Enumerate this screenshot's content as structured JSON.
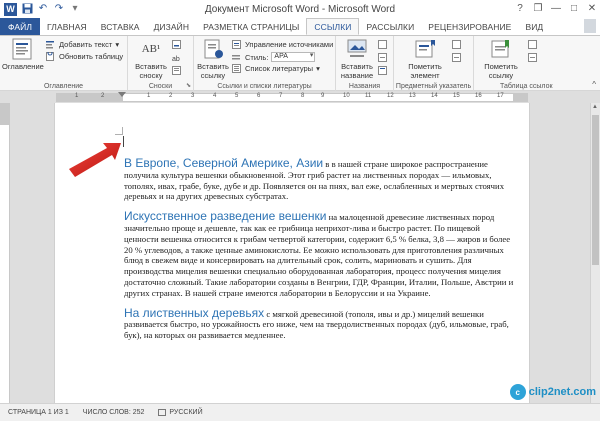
{
  "window": {
    "title": "Документ Microsoft Word - Microsoft Word",
    "help": "?",
    "restore": "❐",
    "minimize": "—",
    "maximize": "□",
    "close": "✕"
  },
  "quick_access": {
    "logo": "W",
    "save": "💾",
    "undo": "↶",
    "redo": "↷",
    "customize": "▾"
  },
  "tabs": [
    {
      "label": "ФАЙЛ"
    },
    {
      "label": "ГЛАВНАЯ"
    },
    {
      "label": "ВСТАВКА"
    },
    {
      "label": "ДИЗАЙН"
    },
    {
      "label": "РАЗМЕТКА СТРАНИЦЫ"
    },
    {
      "label": "ССЫЛКИ"
    },
    {
      "label": "РАССЫЛКИ"
    },
    {
      "label": "РЕЦЕНЗИРОВАНИЕ"
    },
    {
      "label": "ВИД"
    }
  ],
  "ribbon": {
    "toc_group": {
      "label": "Оглавление",
      "toc_button": "Оглавление",
      "add_text": "Добавить текст",
      "update_table": "Обновить таблицу"
    },
    "footnotes_group": {
      "label": "Сноски",
      "insert_footnote_1": "Вставить",
      "insert_footnote_2": "сноску",
      "footnote_icon": "AB¹"
    },
    "citations_group": {
      "label": "Ссылки и списки литературы",
      "insert_citation_1": "Вставить",
      "insert_citation_2": "ссылку",
      "manage_sources": "Управление источниками",
      "style_label": "Стиль:",
      "style_value": "APA",
      "bibliography": "Список литературы"
    },
    "captions_group": {
      "label": "Названия",
      "insert_caption_1": "Вставить",
      "insert_caption_2": "название"
    },
    "index_group": {
      "label": "Предметный указатель",
      "mark_entry_1": "Пометить",
      "mark_entry_2": "элемент"
    },
    "toa_group": {
      "label": "Таблица ссылок",
      "mark_citation_1": "Пометить",
      "mark_citation_2": "ссылку"
    },
    "collapse": "^"
  },
  "ruler": {
    "numbers": [
      "1",
      "2",
      "1",
      "2",
      "3",
      "4",
      "5",
      "6",
      "7",
      "8",
      "9",
      "10",
      "11",
      "12",
      "13",
      "14",
      "15",
      "16",
      "17"
    ]
  },
  "document": {
    "paragraphs": [
      {
        "heading": "В Европе, Северной Америке, Азии",
        "text": " в в нашей стране широкое распространение получила культура вешенки обыкновенной. Этот гриб растет на лиственных породах — ильмовых, тополях, ивах, грабе, буке, дубе и др. Появляется он на пнях, вал еже, ослабленных и мертвых стоячих деревьях и на других древесных субстратах."
      },
      {
        "heading": "Искусственное разведение вешенки",
        "text": " на малоценной древесине лиственных пород значительно проще и дешевле, так как ее грибница неприхот-лива и быстро растет. По пищевой ценности вешенка относится к грибам четвертой категории, содержит 6,5 % белка, 3,8 — жиров и более 20 % углеводов, а также ценные аминокислоты. Ее можно использовать для приготовления различных блюд в свежем виде и консервировать на длительный срок, солить, мариновать и сушить. Для производства мицелия вешенки специально оборудованная лаборатория, процесс получения мицелия достаточно сложный. Такие лаборатории созданы в Венгрии, ГДР, Франции, Италии, Польше, Австрии и других странах. В нашей стране имеются лаборатории в Белоруссии и на Украине."
      },
      {
        "heading": "На лиственных деревьях",
        "text": " с мягкой древесиной (тополя, ивы и др.) мицелий вешенки развивается быстро, но урожайность его ниже, чем на твердолиственных породах (дуб, ильмовые, граб, бук), на которых он развивается медленнее."
      }
    ]
  },
  "status": {
    "page": "СТРАНИЦА 1 ИЗ 1",
    "words": "ЧИСЛО СЛОВ: 252",
    "language": "РУССКИЙ"
  },
  "watermark": {
    "logo": "c",
    "text": "clip2net.com"
  },
  "colors": {
    "accent": "#2b579a",
    "heading": "#2e74b5",
    "arrow": "#d9221c"
  }
}
